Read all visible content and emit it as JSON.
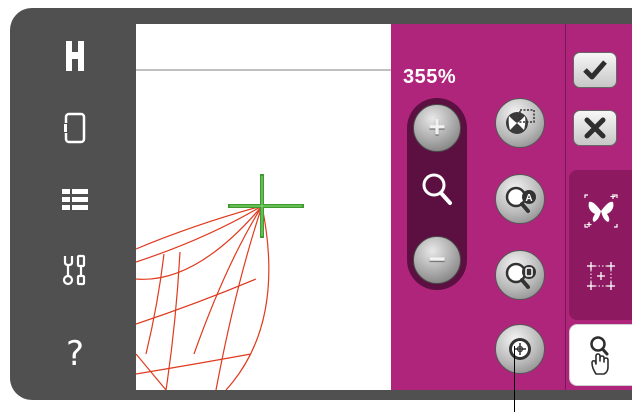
{
  "zoom": {
    "level": "355%"
  },
  "left_toolbar": {
    "items": [
      {
        "name": "home-icon"
      },
      {
        "name": "sewing-mode-icon"
      },
      {
        "name": "menu-list-icon"
      },
      {
        "name": "tools-icon"
      },
      {
        "name": "help-icon",
        "glyph": "?"
      }
    ]
  },
  "zoom_controls": {
    "zoom_in_glyph": "+",
    "zoom_out_glyph": "−",
    "buttons": [
      "zoom-to-all-icon",
      "zoom-to-hoop-icon",
      "zoom-to-box-icon",
      "zoom-to-cursor-icon"
    ]
  },
  "right_strip": {
    "buttons": [
      "ok-check-icon",
      "cancel-x-icon",
      "move-design-icon",
      "position-grid-icon",
      "zoom-pan-touch-icon"
    ]
  },
  "colors": {
    "frame": "#505050",
    "panel": "#b0257c",
    "panel_dark": "#5b1041",
    "stitch_red": "#e03a1e",
    "cursor_green": "#3f9a32"
  }
}
